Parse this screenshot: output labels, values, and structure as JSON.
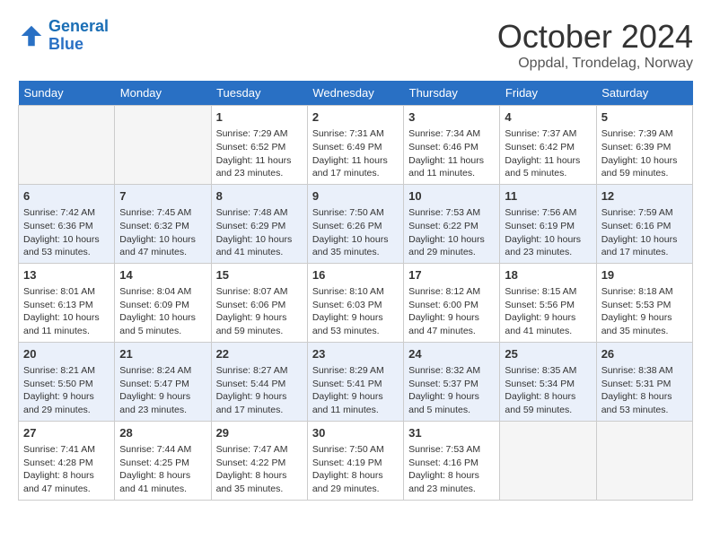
{
  "header": {
    "logo_text_general": "General",
    "logo_text_blue": "Blue",
    "month_title": "October 2024",
    "location": "Oppdal, Trondelag, Norway"
  },
  "weekdays": [
    "Sunday",
    "Monday",
    "Tuesday",
    "Wednesday",
    "Thursday",
    "Friday",
    "Saturday"
  ],
  "weeks": [
    [
      {
        "day": "",
        "empty": true
      },
      {
        "day": "",
        "empty": true
      },
      {
        "day": "1",
        "sunrise": "Sunrise: 7:29 AM",
        "sunset": "Sunset: 6:52 PM",
        "daylight": "Daylight: 11 hours and 23 minutes."
      },
      {
        "day": "2",
        "sunrise": "Sunrise: 7:31 AM",
        "sunset": "Sunset: 6:49 PM",
        "daylight": "Daylight: 11 hours and 17 minutes."
      },
      {
        "day": "3",
        "sunrise": "Sunrise: 7:34 AM",
        "sunset": "Sunset: 6:46 PM",
        "daylight": "Daylight: 11 hours and 11 minutes."
      },
      {
        "day": "4",
        "sunrise": "Sunrise: 7:37 AM",
        "sunset": "Sunset: 6:42 PM",
        "daylight": "Daylight: 11 hours and 5 minutes."
      },
      {
        "day": "5",
        "sunrise": "Sunrise: 7:39 AM",
        "sunset": "Sunset: 6:39 PM",
        "daylight": "Daylight: 10 hours and 59 minutes."
      }
    ],
    [
      {
        "day": "6",
        "sunrise": "Sunrise: 7:42 AM",
        "sunset": "Sunset: 6:36 PM",
        "daylight": "Daylight: 10 hours and 53 minutes."
      },
      {
        "day": "7",
        "sunrise": "Sunrise: 7:45 AM",
        "sunset": "Sunset: 6:32 PM",
        "daylight": "Daylight: 10 hours and 47 minutes."
      },
      {
        "day": "8",
        "sunrise": "Sunrise: 7:48 AM",
        "sunset": "Sunset: 6:29 PM",
        "daylight": "Daylight: 10 hours and 41 minutes."
      },
      {
        "day": "9",
        "sunrise": "Sunrise: 7:50 AM",
        "sunset": "Sunset: 6:26 PM",
        "daylight": "Daylight: 10 hours and 35 minutes."
      },
      {
        "day": "10",
        "sunrise": "Sunrise: 7:53 AM",
        "sunset": "Sunset: 6:22 PM",
        "daylight": "Daylight: 10 hours and 29 minutes."
      },
      {
        "day": "11",
        "sunrise": "Sunrise: 7:56 AM",
        "sunset": "Sunset: 6:19 PM",
        "daylight": "Daylight: 10 hours and 23 minutes."
      },
      {
        "day": "12",
        "sunrise": "Sunrise: 7:59 AM",
        "sunset": "Sunset: 6:16 PM",
        "daylight": "Daylight: 10 hours and 17 minutes."
      }
    ],
    [
      {
        "day": "13",
        "sunrise": "Sunrise: 8:01 AM",
        "sunset": "Sunset: 6:13 PM",
        "daylight": "Daylight: 10 hours and 11 minutes."
      },
      {
        "day": "14",
        "sunrise": "Sunrise: 8:04 AM",
        "sunset": "Sunset: 6:09 PM",
        "daylight": "Daylight: 10 hours and 5 minutes."
      },
      {
        "day": "15",
        "sunrise": "Sunrise: 8:07 AM",
        "sunset": "Sunset: 6:06 PM",
        "daylight": "Daylight: 9 hours and 59 minutes."
      },
      {
        "day": "16",
        "sunrise": "Sunrise: 8:10 AM",
        "sunset": "Sunset: 6:03 PM",
        "daylight": "Daylight: 9 hours and 53 minutes."
      },
      {
        "day": "17",
        "sunrise": "Sunrise: 8:12 AM",
        "sunset": "Sunset: 6:00 PM",
        "daylight": "Daylight: 9 hours and 47 minutes."
      },
      {
        "day": "18",
        "sunrise": "Sunrise: 8:15 AM",
        "sunset": "Sunset: 5:56 PM",
        "daylight": "Daylight: 9 hours and 41 minutes."
      },
      {
        "day": "19",
        "sunrise": "Sunrise: 8:18 AM",
        "sunset": "Sunset: 5:53 PM",
        "daylight": "Daylight: 9 hours and 35 minutes."
      }
    ],
    [
      {
        "day": "20",
        "sunrise": "Sunrise: 8:21 AM",
        "sunset": "Sunset: 5:50 PM",
        "daylight": "Daylight: 9 hours and 29 minutes."
      },
      {
        "day": "21",
        "sunrise": "Sunrise: 8:24 AM",
        "sunset": "Sunset: 5:47 PM",
        "daylight": "Daylight: 9 hours and 23 minutes."
      },
      {
        "day": "22",
        "sunrise": "Sunrise: 8:27 AM",
        "sunset": "Sunset: 5:44 PM",
        "daylight": "Daylight: 9 hours and 17 minutes."
      },
      {
        "day": "23",
        "sunrise": "Sunrise: 8:29 AM",
        "sunset": "Sunset: 5:41 PM",
        "daylight": "Daylight: 9 hours and 11 minutes."
      },
      {
        "day": "24",
        "sunrise": "Sunrise: 8:32 AM",
        "sunset": "Sunset: 5:37 PM",
        "daylight": "Daylight: 9 hours and 5 minutes."
      },
      {
        "day": "25",
        "sunrise": "Sunrise: 8:35 AM",
        "sunset": "Sunset: 5:34 PM",
        "daylight": "Daylight: 8 hours and 59 minutes."
      },
      {
        "day": "26",
        "sunrise": "Sunrise: 8:38 AM",
        "sunset": "Sunset: 5:31 PM",
        "daylight": "Daylight: 8 hours and 53 minutes."
      }
    ],
    [
      {
        "day": "27",
        "sunrise": "Sunrise: 7:41 AM",
        "sunset": "Sunset: 4:28 PM",
        "daylight": "Daylight: 8 hours and 47 minutes."
      },
      {
        "day": "28",
        "sunrise": "Sunrise: 7:44 AM",
        "sunset": "Sunset: 4:25 PM",
        "daylight": "Daylight: 8 hours and 41 minutes."
      },
      {
        "day": "29",
        "sunrise": "Sunrise: 7:47 AM",
        "sunset": "Sunset: 4:22 PM",
        "daylight": "Daylight: 8 hours and 35 minutes."
      },
      {
        "day": "30",
        "sunrise": "Sunrise: 7:50 AM",
        "sunset": "Sunset: 4:19 PM",
        "daylight": "Daylight: 8 hours and 29 minutes."
      },
      {
        "day": "31",
        "sunrise": "Sunrise: 7:53 AM",
        "sunset": "Sunset: 4:16 PM",
        "daylight": "Daylight: 8 hours and 23 minutes."
      },
      {
        "day": "",
        "empty": true
      },
      {
        "day": "",
        "empty": true
      }
    ]
  ]
}
